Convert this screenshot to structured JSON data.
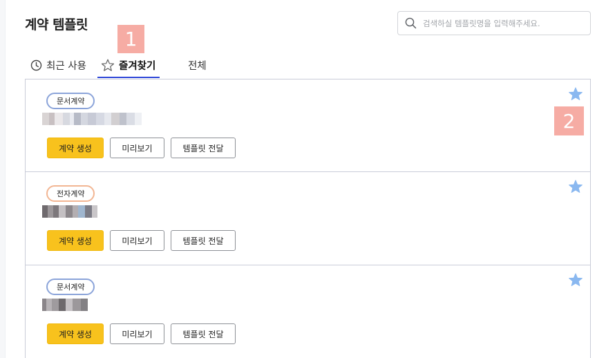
{
  "page": {
    "title": "계약 템플릿"
  },
  "search": {
    "placeholder": "검색하실 템플릿명을 입력해주세요.",
    "icon": "search-icon"
  },
  "markers": [
    "1",
    "2"
  ],
  "tabs": [
    {
      "label": "최근 사용",
      "icon": "clock-icon",
      "active": false
    },
    {
      "label": "즐겨찾기",
      "icon": "star-outline-icon",
      "active": true
    },
    {
      "label": "전체",
      "active": false
    }
  ],
  "colors": {
    "accent_underline": "#2c45d8",
    "primary_button": "#f8c21d",
    "favorite_star": "#8ab8f0",
    "badge_document": "#8aa3d9",
    "badge_electronic": "#f2b592",
    "marker": "#f6a8a0"
  },
  "templates": [
    {
      "badge": "문서계약",
      "badge_type": "document",
      "favorited": true,
      "actions": {
        "create": "계약 생성",
        "preview": "미리보기",
        "send": "템플릿 전달"
      }
    },
    {
      "badge": "전자계약",
      "badge_type": "electronic",
      "favorited": true,
      "actions": {
        "create": "계약 생성",
        "preview": "미리보기",
        "send": "템플릿 전달"
      }
    },
    {
      "badge": "문서계약",
      "badge_type": "document",
      "favorited": true,
      "actions": {
        "create": "계약 생성",
        "preview": "미리보기",
        "send": "템플릿 전달"
      }
    }
  ]
}
